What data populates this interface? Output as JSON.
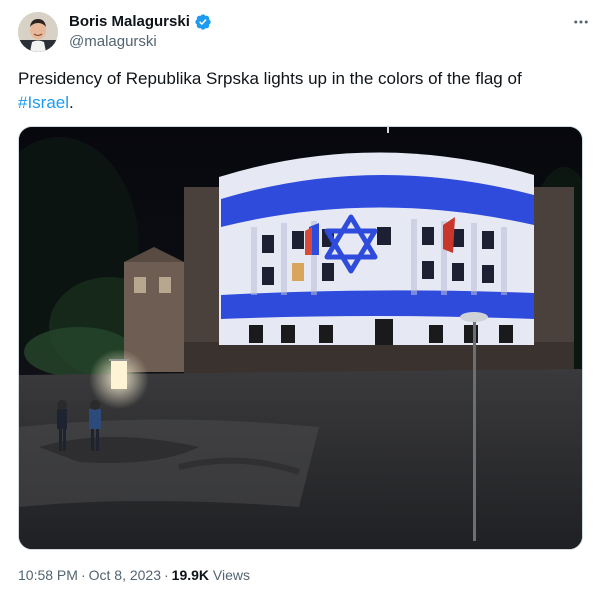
{
  "author": {
    "display_name": "Boris Malagurski",
    "handle": "@malagurski",
    "verified_icon": "verified-badge-icon",
    "avatar_icon": "profile-photo"
  },
  "more_menu_icon": "more-options-icon",
  "tweet": {
    "text": "Presidency of Republika Srpska lights up in the colors of the flag of ",
    "hashtag": "#Israel",
    "text_end": "."
  },
  "media": {
    "description_icon": "photo-of-building-lit-with-israel-flag",
    "flag_colors": {
      "blue": "#2f4bdc",
      "white": "#e9ecf7"
    }
  },
  "meta": {
    "time": "10:58 PM",
    "separator": "·",
    "date": "Oct 8, 2023",
    "views_count": "19.9K",
    "views_label": "Views"
  },
  "colors": {
    "accent": "#1d9bf0",
    "text": "#0f1419",
    "muted": "#536471"
  }
}
